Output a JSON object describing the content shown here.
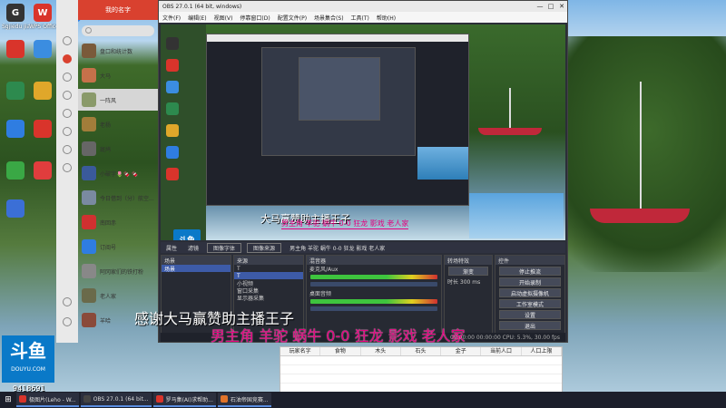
{
  "desktop": {
    "icons": [
      {
        "label": "Sgjiedu jiasu...",
        "glyph": "G",
        "color": "#333333"
      },
      {
        "label": "WPS Office",
        "glyph": "W",
        "color": "#d9342b"
      },
      {
        "label": "",
        "glyph": "K",
        "color": "#2f7de1"
      },
      {
        "label": "",
        "glyph": "",
        "color": "#d9342b"
      },
      {
        "label": "",
        "glyph": "",
        "color": "#3b8de0"
      },
      {
        "label": "",
        "glyph": "",
        "color": "#2d8a4e"
      },
      {
        "label": "",
        "glyph": "",
        "color": "#e0a72a"
      },
      {
        "label": "",
        "glyph": "",
        "color": "#2f7de1"
      },
      {
        "label": "",
        "glyph": "",
        "color": "#d9342b"
      },
      {
        "label": "",
        "glyph": "",
        "color": "#3aa845"
      },
      {
        "label": "",
        "glyph": "",
        "color": "#e03d3d"
      },
      {
        "label": "",
        "glyph": "",
        "color": "#3b6fd6"
      }
    ]
  },
  "chat": {
    "title": "我的名字",
    "contacts": [
      {
        "name": "盘口和统计数",
        "color": "#7a5a3a"
      },
      {
        "name": "大马",
        "color": "#c6714a"
      },
      {
        "name": "一阵风",
        "color": "#8a9a6a"
      },
      {
        "name": "老杨",
        "color": "#a27d3a"
      },
      {
        "name": "斑鸠",
        "color": "#666666"
      },
      {
        "name": "小破字🌷🍫 🍫",
        "color": "#3a5a9a"
      },
      {
        "name": "今日借到（分）航空...",
        "color": "#7a8aa0"
      },
      {
        "name": "南回赤",
        "color": "#d03030"
      },
      {
        "name": "订阅号",
        "color": "#2f7de1"
      },
      {
        "name": "阿冈家们的铁打粉",
        "color": "#888888"
      },
      {
        "name": "老人家",
        "color": "#6a6a4a"
      },
      {
        "name": "羊哈",
        "color": "#8a4a3a"
      }
    ]
  },
  "obs": {
    "title": "OBS 27.0.1 (64 bit, windows)",
    "menu": [
      "文件(F)",
      "编辑(E)",
      "视图(V)",
      "停靠窗口(D)",
      "配置文件(P)",
      "场景集合(S)",
      "工具(T)",
      "帮助(H)"
    ],
    "preview_caption": "大马赢赞助主播王子",
    "preview_red_text": "男主角 羊驼 蜗牛 0-0 狂龙 影戏 老人家",
    "preview_logo": "斗鱼",
    "toolbar_tabs": [
      "属性",
      "滤镜",
      "图像字体",
      "图像来源",
      "男主角 羊驼 蜗牛 0-0 狂龙 影戏 老人家"
    ],
    "docks": {
      "scenes_title": "场景",
      "scenes": [
        "场景"
      ],
      "sources_title": "来源",
      "sources": [
        "T",
        "T",
        "小视频",
        "窗口采集",
        "显示器采集"
      ],
      "mixer_title": "混音器",
      "mixer_tracks": [
        "麦克风/Aux",
        "桌面音频"
      ],
      "transition_title": "转场特效",
      "transition_value": "渐变",
      "transition_duration": "时长 300 ms",
      "controls_title": "控件",
      "controls": [
        "停止推流",
        "开始录制",
        "启动虚拟摄像机",
        "工作室模式",
        "设置",
        "退出"
      ]
    },
    "status": "00:00:00  00:00:00  CPU: 5.3%, 30.00 fps"
  },
  "stream_overlay": {
    "white_caption": "感谢大马赢赞助主播王子",
    "red_caption": "男主角 羊驼 蜗牛 0-0 狂龙 影戏 老人家"
  },
  "douyu": {
    "brand": "斗鱼",
    "site": "DOUYU.COM",
    "room": "9418691"
  },
  "gift_table": {
    "columns": [
      "玩家名字",
      "食物",
      "木头",
      "石头",
      "金子",
      "当前人口",
      "人口上限"
    ]
  },
  "taskbar": {
    "items": [
      {
        "label": "极图片(Leho - W...",
        "color": "#d9342b"
      },
      {
        "label": "OBS 27.0.1 (64 bit...",
        "color": "#444444"
      },
      {
        "label": "罗马集(AI)求帮助...",
        "color": "#d9342b"
      },
      {
        "label": "石油帝国竞赛...",
        "color": "#e0732a"
      }
    ]
  }
}
